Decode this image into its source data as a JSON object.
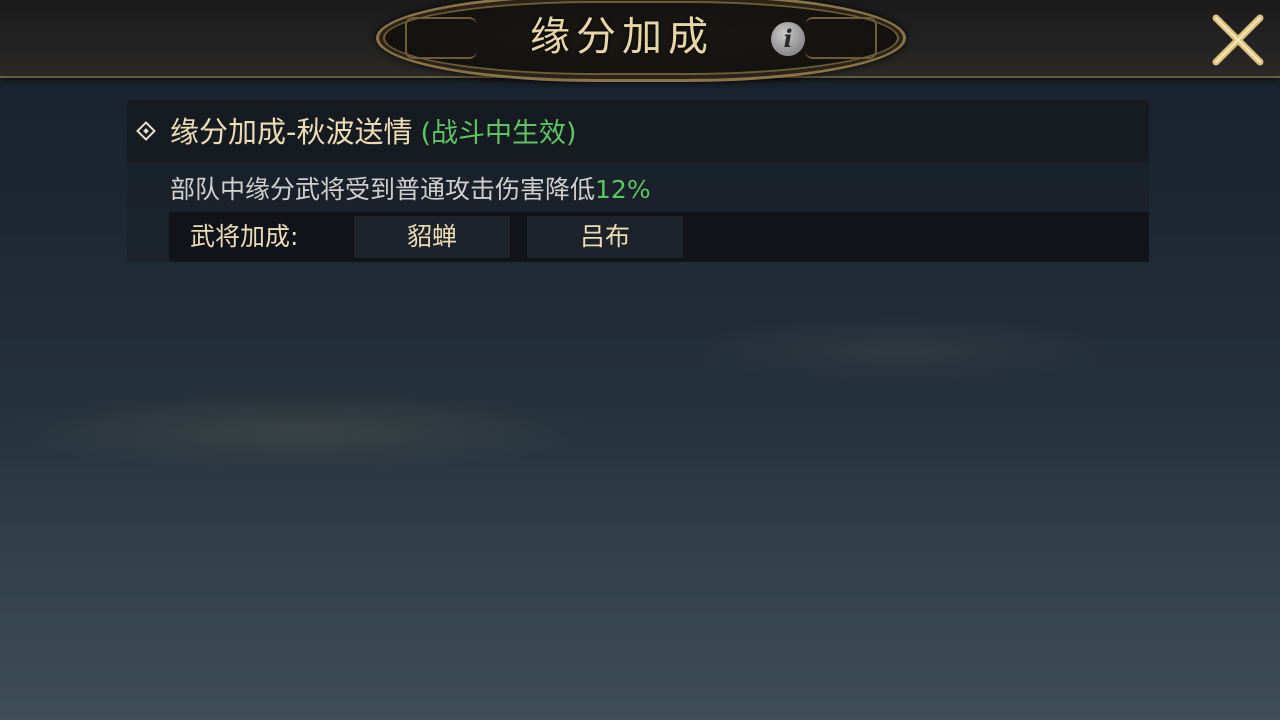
{
  "header": {
    "title": "缘分加成",
    "info_icon": "info-icon",
    "close_icon": "close-x-icon"
  },
  "bonus": {
    "title": "缘分加成-秋波送情",
    "effect_note": "(战斗中生效)",
    "description": "部队中缘分武将受到普通攻击伤害降低",
    "description_value": "12%",
    "generals_label": "武将加成:",
    "generals": [
      "貂蝉",
      "吕布"
    ]
  },
  "colors": {
    "gold_text": "#ecdcb4",
    "green_highlight": "#5fc464",
    "frame_gold": "#8b7448"
  }
}
